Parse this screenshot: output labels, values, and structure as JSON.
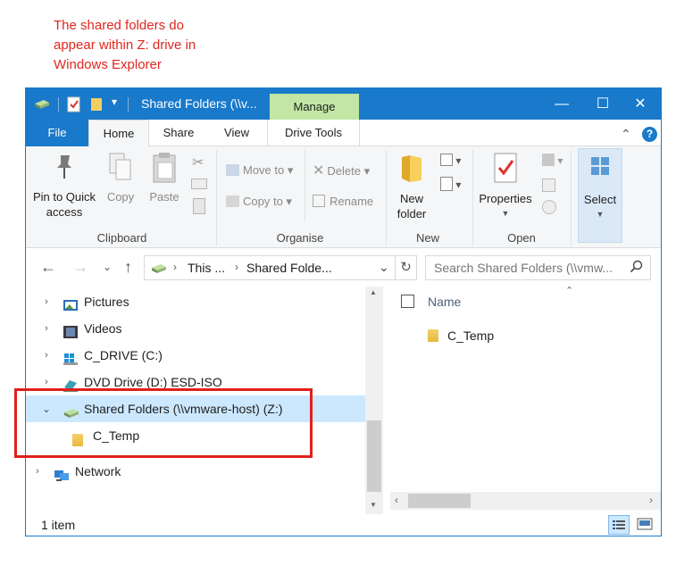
{
  "annotation": {
    "line1": "The shared folders do",
    "line2": "appear within Z: drive in",
    "line3": "Windows Explorer"
  },
  "window": {
    "title": "Shared Folders (\\\\v...",
    "context_tab": "Manage",
    "controls": {
      "minimize": "—",
      "maximize": "☐",
      "close": "✕"
    }
  },
  "tabs": {
    "file": "File",
    "home": "Home",
    "share": "Share",
    "view": "View",
    "drive_tools": "Drive Tools",
    "collapse": "⌃",
    "help": "?"
  },
  "ribbon": {
    "clipboard": {
      "label": "Clipboard",
      "pin_line1": "Pin to Quick",
      "pin_line2": "access",
      "copy": "Copy",
      "paste": "Paste"
    },
    "organise": {
      "label": "Organise",
      "move_to": "Move to",
      "copy_to": "Copy to",
      "delete": "Delete",
      "rename": "Rename"
    },
    "new": {
      "label": "New",
      "new_folder_line1": "New",
      "new_folder_line2": "folder"
    },
    "open": {
      "label": "Open",
      "properties": "Properties"
    },
    "select": {
      "label": "Select"
    }
  },
  "address": {
    "crumb1": "This ...",
    "crumb2": "Shared Folde...",
    "search_placeholder": "Search Shared Folders (\\\\vmw..."
  },
  "nav_items": [
    {
      "label": "Pictures"
    },
    {
      "label": "Videos"
    },
    {
      "label": "C_DRIVE (C:)"
    },
    {
      "label": "DVD Drive (D:) ESD-ISO"
    },
    {
      "label": "Shared Folders (\\\\vmware-host) (Z:)"
    },
    {
      "label": "C_Temp"
    },
    {
      "label": "Network"
    }
  ],
  "content": {
    "column_name": "Name",
    "items": [
      {
        "label": "C_Temp"
      }
    ]
  },
  "status": {
    "item_count": "1 item"
  },
  "colors": {
    "titlebar": "#1979ca",
    "manage_tab": "#c3e6a5",
    "selection": "#cce8ff",
    "highlight_box": "#e0201d",
    "annotation_text": "#e0261f"
  }
}
